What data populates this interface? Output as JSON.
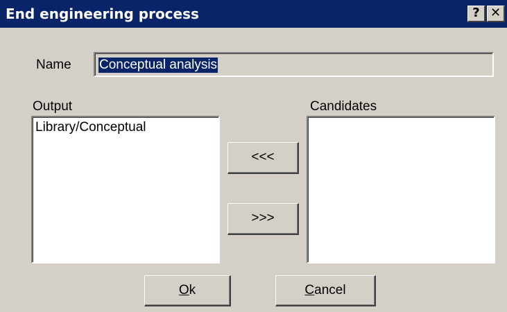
{
  "dialog": {
    "title": "End engineering process",
    "help_button": "?",
    "close_button": "✕"
  },
  "name_row": {
    "label": "Name",
    "value": "Conceptual analysis"
  },
  "output": {
    "label": "Output",
    "items": [
      "Library/Conceptual"
    ]
  },
  "candidates": {
    "label": "Candidates",
    "items": []
  },
  "transfer": {
    "move_left_label": "<<<",
    "move_right_label": ">>>"
  },
  "buttons": {
    "ok_mnemonic": "O",
    "ok_rest": "k",
    "cancel_mnemonic": "C",
    "cancel_rest": "ancel"
  },
  "colors": {
    "titlebar": "#0a246a",
    "face": "#d4d0c8",
    "selection": "#0a246a"
  }
}
